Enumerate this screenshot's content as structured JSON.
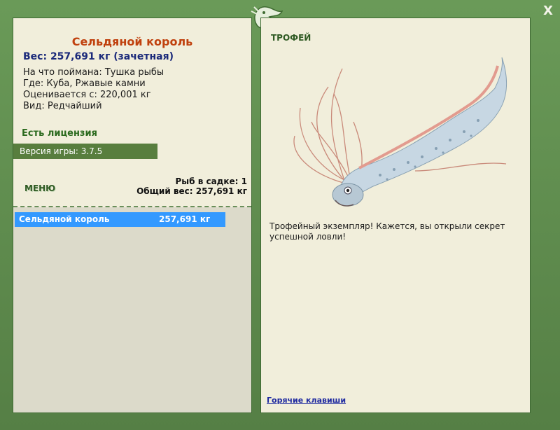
{
  "header": {
    "close_label": "X"
  },
  "left": {
    "fish_name": "Сельдяной король",
    "weight_line": "Вес: 257,691 кг (зачетная)",
    "details": [
      "На что поймана: Тушка рыбы",
      "Где: Куба, Ржавые камни",
      "Оценивается с: 220,001 кг",
      "Вид: Редчайший"
    ],
    "license": "Есть лицензия",
    "version": "Версия игры: 3.7.5",
    "menu": "МЕНЮ",
    "stats": {
      "count": "Рыб в садке: 1",
      "total": "Общий вес: 257,691 кг"
    },
    "catch_list": [
      {
        "name": "Сельдяной король",
        "weight": "257,691 кг"
      }
    ]
  },
  "right": {
    "trophy": "ТРОФЕЙ",
    "description": "Трофейный экземпляр! Кажется, вы открыли секрет успешной ловли!",
    "hotkeys": "Горячие клавиши"
  },
  "colors": {
    "frame": "#5f8f4e",
    "panel": "#f1eedb",
    "accent_red": "#c0410e",
    "weight_blue": "#1b2a7a",
    "selection": "#3399ff",
    "version_bar": "#587e3e"
  },
  "icons": {
    "top_emblem": "dragon-emblem-icon",
    "close": "close-icon"
  }
}
